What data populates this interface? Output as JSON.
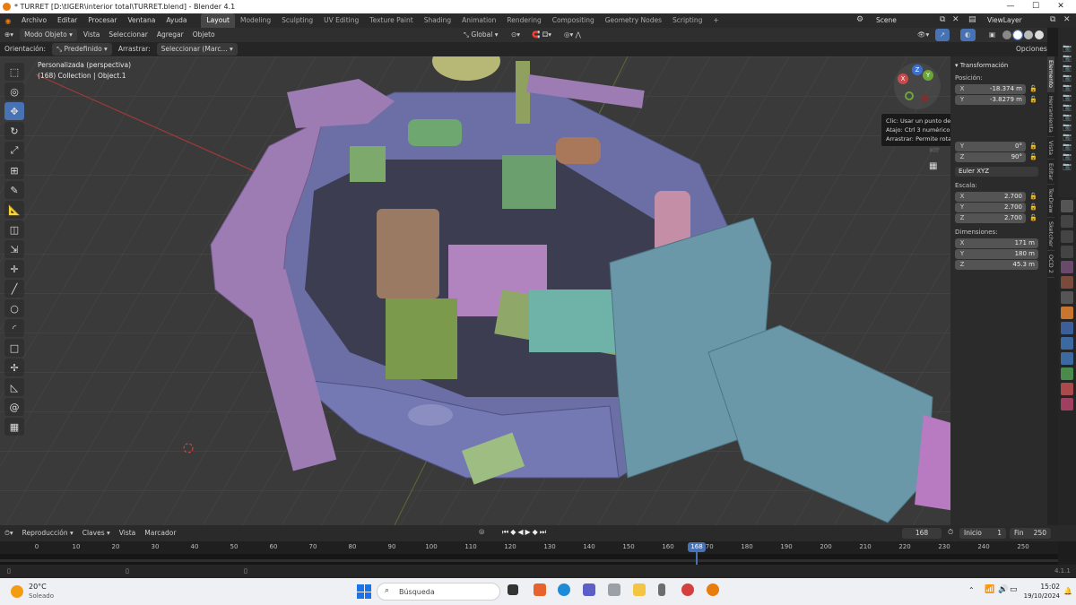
{
  "titlebar": {
    "title": "* TURRET [D:\\tIGER\\interior total\\TURRET.blend] - Blender 4.1",
    "min": "—",
    "max": "☐",
    "close": "✕"
  },
  "menu": {
    "items": [
      "Archivo",
      "Editar",
      "Procesar",
      "Ventana",
      "Ayuda"
    ]
  },
  "workspaces": [
    "Layout",
    "Modeling",
    "Sculpting",
    "UV Editing",
    "Texture Paint",
    "Shading",
    "Animation",
    "Rendering",
    "Compositing",
    "Geometry Nodes",
    "Scripting",
    "+"
  ],
  "scene": {
    "scene_label": "Scene",
    "viewlayer_label": "ViewLayer"
  },
  "viewport_header": {
    "mode": "Modo Objeto",
    "view": "Vista",
    "select": "Seleccionar",
    "add": "Agregar",
    "object": "Objeto",
    "transform_orientation": "Global",
    "options": "Opciones"
  },
  "tool_settings": {
    "orientation_label": "Orientación:",
    "orientation_value": "Predefinido",
    "drag_label": "Arrastrar:",
    "drag_value": "Seleccionar (Marc..."
  },
  "overlay_text": {
    "view_name": "Personalizada (perspectiva)",
    "collection": "(168) Collection | Object.1"
  },
  "gizmo": {
    "x": "X",
    "y": "Y",
    "z": "Z"
  },
  "tooltip": {
    "line1": "Clic: Usar un punto de vista predefinido",
    "line2": "Atajo: Ctrl 3 numérico",
    "line3": "Arrastrar: Permite rotar la vista"
  },
  "npanel": {
    "header": "Transformación",
    "position_label": "Posición:",
    "position": [
      {
        "axis": "X",
        "value": "-18.374 m"
      },
      {
        "axis": "Y",
        "value": "-3.8279 m"
      }
    ],
    "rotation": [
      {
        "axis": "Y",
        "value": "0°"
      },
      {
        "axis": "Z",
        "value": "90°"
      }
    ],
    "rotation_mode": "Euler XYZ",
    "scale_label": "Escala:",
    "scale": [
      {
        "axis": "X",
        "value": "2.700"
      },
      {
        "axis": "Y",
        "value": "2.700"
      },
      {
        "axis": "Z",
        "value": "2.700"
      }
    ],
    "dimensions_label": "Dimensiones:",
    "dimensions": [
      {
        "axis": "X",
        "value": "171 m"
      },
      {
        "axis": "Y",
        "value": "180 m"
      },
      {
        "axis": "Z",
        "value": "45.3 m"
      }
    ]
  },
  "ntabs": [
    "Elemento",
    "Herramienta",
    "Vista",
    "Editar",
    "TexDraw",
    "Sketcher",
    "OCD 2"
  ],
  "timeline": {
    "playback": "Reproducción",
    "keys": "Claves",
    "view": "Vista",
    "marker": "Marcador",
    "current_frame": "168",
    "start_label": "Inicio",
    "start": "1",
    "end_label": "Fin",
    "end": "250",
    "ticks": [
      "0",
      "10",
      "20",
      "30",
      "40",
      "50",
      "60",
      "70",
      "80",
      "90",
      "100",
      "110",
      "120",
      "130",
      "140",
      "150",
      "160",
      "170",
      "180",
      "190",
      "200",
      "210",
      "220",
      "230",
      "240",
      "250"
    ],
    "current_badge": "168"
  },
  "statusbar": {
    "version": "4.1.1"
  },
  "taskbar": {
    "temp": "20°C",
    "weather": "Soleado",
    "search": "Búsqueda",
    "time": "15:02",
    "date": "19/10/2024"
  },
  "colors": {
    "accent": "#4772b3",
    "grid_bg": "#3a3a3a",
    "turret_blue": "#6b6fa6",
    "turret_purple": "#9c7cb3",
    "gun_teal": "#6a98a8",
    "barrel_pink": "#b87ac0"
  }
}
